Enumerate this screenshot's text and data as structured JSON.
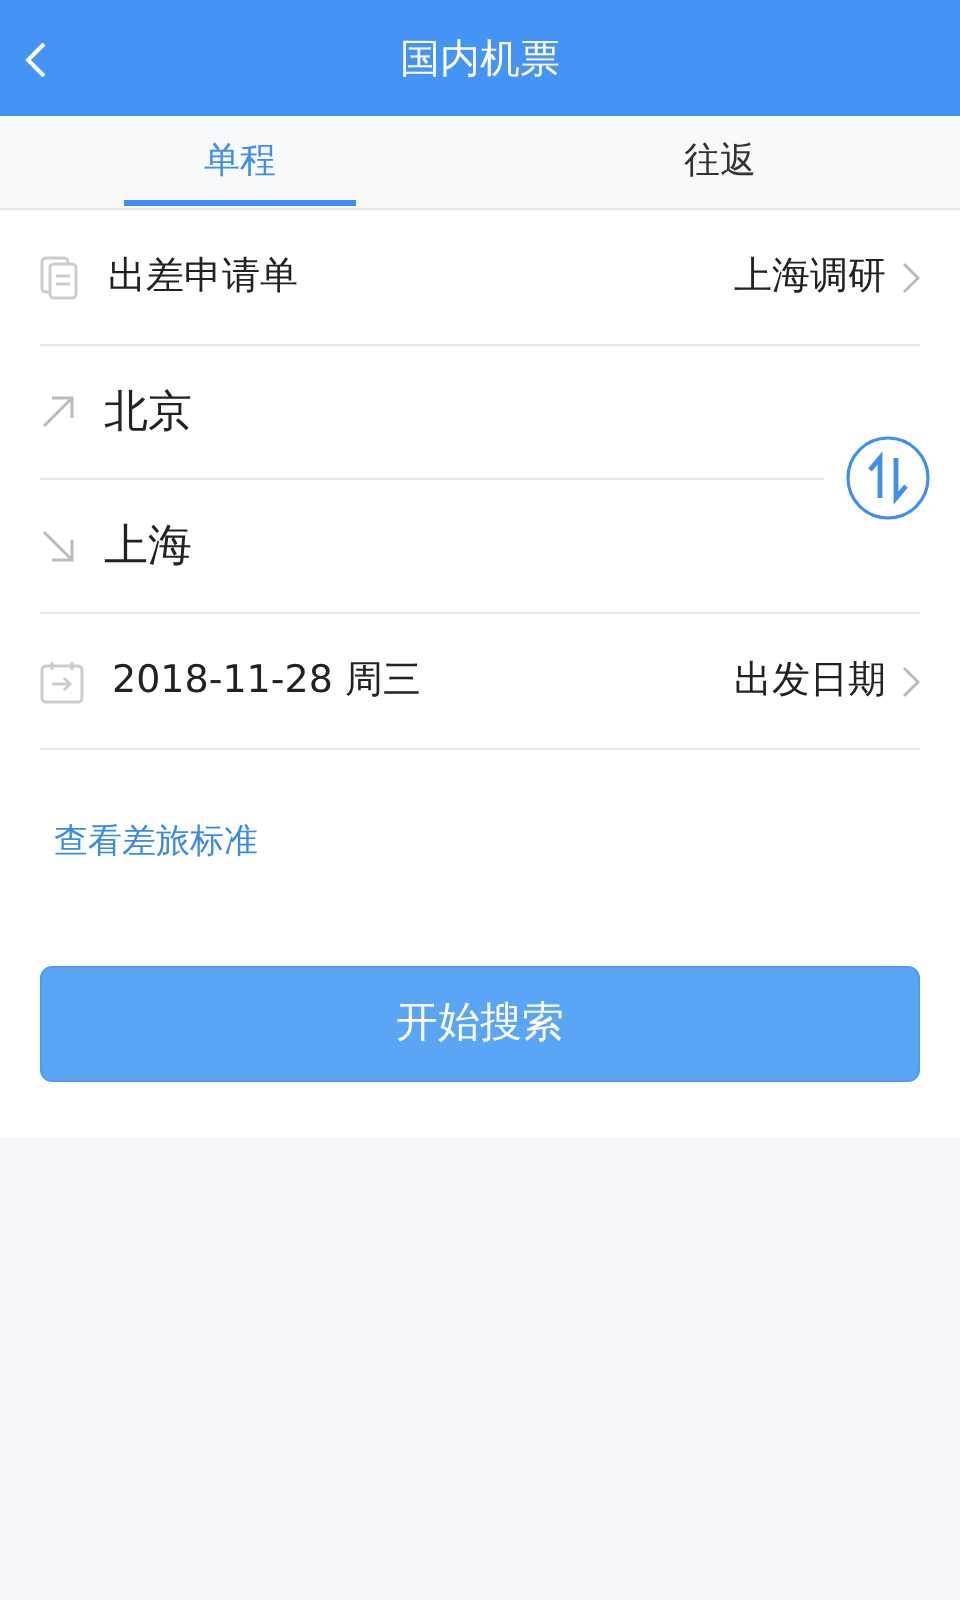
{
  "header": {
    "title": "国内机票"
  },
  "tabs": [
    {
      "label": "单程",
      "selected": true
    },
    {
      "label": "往返",
      "selected": false
    }
  ],
  "trip_request": {
    "label": "出差申请单",
    "value": "上海调研"
  },
  "route": {
    "from": "北京",
    "to": "上海"
  },
  "date": {
    "value": "2018-11-28 周三",
    "label": "出发日期"
  },
  "policy_link": "查看差旅标准",
  "search_button": "开始搜索"
}
